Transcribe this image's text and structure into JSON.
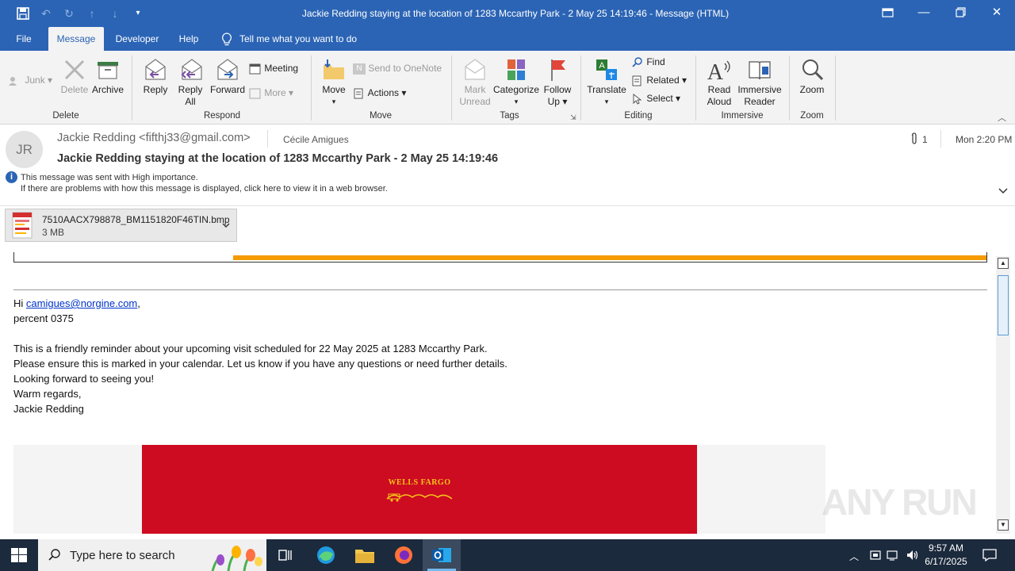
{
  "window": {
    "title": "Jackie Redding staying at the location of 1283 Mccarthy Park - 2 May 25 14:19:46  -  Message (HTML)"
  },
  "tabs": [
    "File",
    "Message",
    "Developer",
    "Help"
  ],
  "tell_me": "Tell me what you want to do",
  "ribbon": {
    "delete": {
      "junk": "Junk",
      "delete": "Delete",
      "archive": "Archive",
      "group": "Delete"
    },
    "respond": {
      "reply": "Reply",
      "reply_all_1": "Reply",
      "reply_all_2": "All",
      "forward": "Forward",
      "meeting": "Meeting",
      "more": "More",
      "group": "Respond"
    },
    "move": {
      "move": "Move",
      "onenote": "Send to OneNote",
      "actions": "Actions",
      "group": "Move"
    },
    "tags": {
      "mark_1": "Mark",
      "mark_2": "Unread",
      "categorize": "Categorize",
      "follow_1": "Follow",
      "follow_2": "Up",
      "group": "Tags"
    },
    "editing": {
      "translate": "Translate",
      "find": "Find",
      "related": "Related",
      "select": "Select",
      "group": "Editing"
    },
    "immersive": {
      "read_1": "Read",
      "read_2": "Aloud",
      "imm_1": "Immersive",
      "imm_2": "Reader",
      "group": "Immersive"
    },
    "zoom": {
      "zoom": "Zoom",
      "group": "Zoom"
    }
  },
  "message": {
    "avatar": "JR",
    "from": "Jackie Redding <fifthj33@gmail.com>",
    "to": "Cécile Amigues",
    "attach_count": "1",
    "date": "Mon 2:20 PM",
    "subject": "Jackie Redding staying at the location of 1283 Mccarthy Park - 2 May 25 14:19:46",
    "info_1": "This message was sent with High importance.",
    "info_2": "If there are problems with how this message is displayed, click here to view it in a web browser.",
    "attachment": {
      "name": "7510AACX798878_BM1151820F46TIN.bmp",
      "size": "3 MB"
    }
  },
  "body": {
    "greeting_hi": "Hi ",
    "email_link": "camigues@norgine.com",
    "comma": ",",
    "line_percent": "percent 0375",
    "para_1": "This is a friendly reminder about your upcoming visit scheduled for 22 May 2025 at 1283 Mccarthy Park.",
    "para_2": "Please ensure this is marked in your calendar. Let us know if you have any questions or need further details.",
    "para_3": "Looking forward to seeing you!",
    "para_4": "Warm regards,",
    "para_5": "Jackie Redding",
    "banner_brand": "WELLS FARGO",
    "watermark": "ANY RUN"
  },
  "taskbar": {
    "search": "Type here to search",
    "time": "9:57 AM",
    "date": "6/17/2025"
  },
  "colors": {
    "accent": "#2b64b5",
    "banner": "#cd0b21",
    "orange_bar": "#f59b00"
  }
}
